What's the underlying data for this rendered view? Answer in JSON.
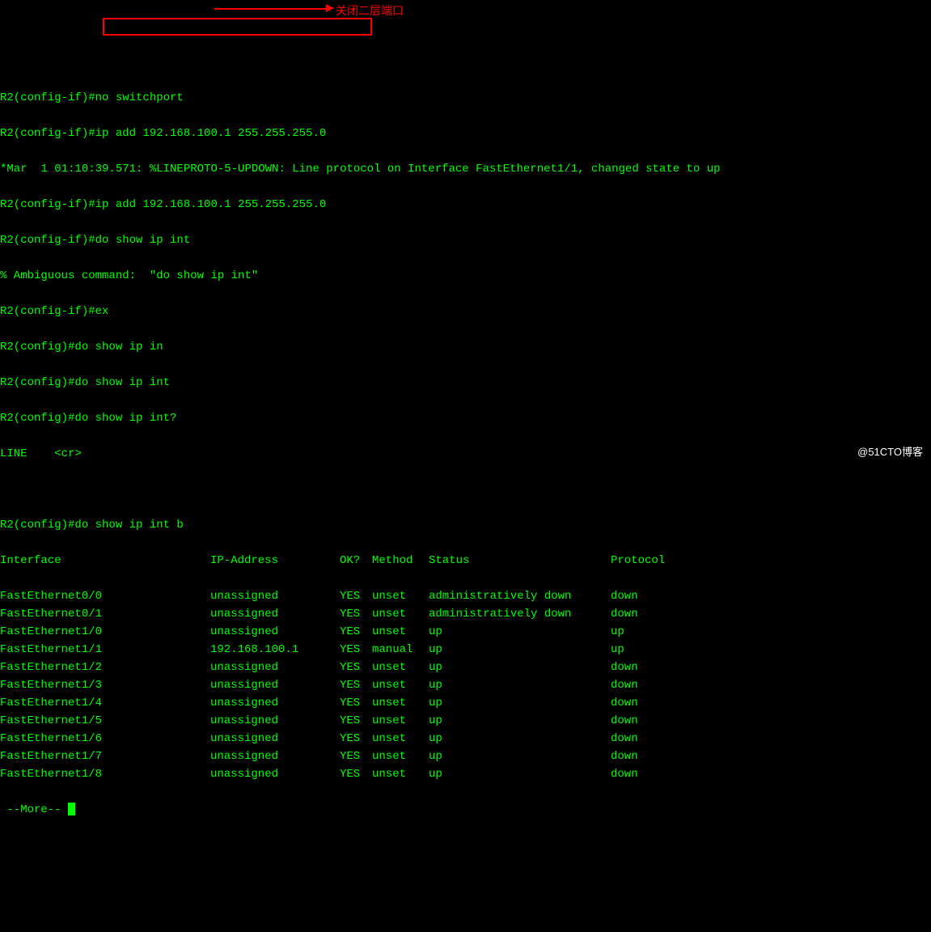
{
  "annotation": {
    "text": "关闭二层端口"
  },
  "lines": {
    "l1": "R2(config-if)#no switchport",
    "l2": "R2(config-if)#ip add 192.168.100.1 255.255.255.0",
    "l3": "*Mar  1 01:10:39.571: %LINEPROTO-5-UPDOWN: Line protocol on Interface FastEthernet1/1, changed state to up",
    "l4": "R2(config-if)#ip add 192.168.100.1 255.255.255.0",
    "l5": "R2(config-if)#do show ip int",
    "l6": "% Ambiguous command:  \"do show ip int\"",
    "l7": "R2(config-if)#ex",
    "l8": "R2(config)#do show ip in",
    "l9": "R2(config)#do show ip int",
    "l10": "R2(config)#do show ip int?",
    "l11": "LINE    <cr>",
    "l12": "",
    "l13": "R2(config)#do show ip int b"
  },
  "table": {
    "headers": {
      "interface": "Interface",
      "ip": "IP-Address",
      "ok": "OK?",
      "method": "Method",
      "status": "Status",
      "protocol": "Protocol"
    },
    "rows": [
      {
        "interface": "FastEthernet0/0",
        "ip": "unassigned",
        "ok": "YES",
        "method": "unset",
        "status": "administratively down",
        "protocol": "down"
      },
      {
        "interface": "FastEthernet0/1",
        "ip": "unassigned",
        "ok": "YES",
        "method": "unset",
        "status": "administratively down",
        "protocol": "down"
      },
      {
        "interface": "FastEthernet1/0",
        "ip": "unassigned",
        "ok": "YES",
        "method": "unset",
        "status": "up",
        "protocol": "up"
      },
      {
        "interface": "FastEthernet1/1",
        "ip": "192.168.100.1",
        "ok": "YES",
        "method": "manual",
        "status": "up",
        "protocol": "up"
      },
      {
        "interface": "FastEthernet1/2",
        "ip": "unassigned",
        "ok": "YES",
        "method": "unset",
        "status": "up",
        "protocol": "down"
      },
      {
        "interface": "FastEthernet1/3",
        "ip": "unassigned",
        "ok": "YES",
        "method": "unset",
        "status": "up",
        "protocol": "down"
      },
      {
        "interface": "FastEthernet1/4",
        "ip": "unassigned",
        "ok": "YES",
        "method": "unset",
        "status": "up",
        "protocol": "down"
      },
      {
        "interface": "FastEthernet1/5",
        "ip": "unassigned",
        "ok": "YES",
        "method": "unset",
        "status": "up",
        "protocol": "down"
      },
      {
        "interface": "FastEthernet1/6",
        "ip": "unassigned",
        "ok": "YES",
        "method": "unset",
        "status": "up",
        "protocol": "down"
      },
      {
        "interface": "FastEthernet1/7",
        "ip": "unassigned",
        "ok": "YES",
        "method": "unset",
        "status": "up",
        "protocol": "down"
      },
      {
        "interface": "FastEthernet1/8",
        "ip": "unassigned",
        "ok": "YES",
        "method": "unset",
        "status": "up",
        "protocol": "down"
      }
    ]
  },
  "more": " --More-- ",
  "watermark": "@51CTO博客"
}
